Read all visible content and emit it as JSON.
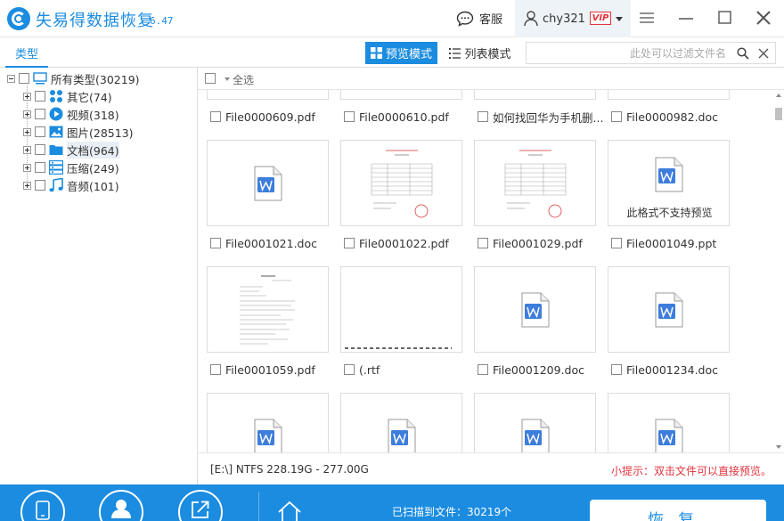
{
  "app": {
    "title": "失易得数据恢复",
    "version": "6.47",
    "service_label": "客服",
    "user_name": "chy321",
    "vip_label": "VIP"
  },
  "toolbar": {
    "tab_type": "类型",
    "preview_mode": "预览模式",
    "list_mode": "列表模式",
    "search_placeholder": "此处可以过滤文件名"
  },
  "tree": {
    "root": "所有类型(30219)",
    "items": [
      {
        "label": "其它(74)",
        "icon": "apps-icon"
      },
      {
        "label": "视频(318)",
        "icon": "video-icon"
      },
      {
        "label": "图片(28513)",
        "icon": "image-icon"
      },
      {
        "label": "文档(964)",
        "icon": "folder-icon"
      },
      {
        "label": "压缩(249)",
        "icon": "archive-icon"
      },
      {
        "label": "音频(101)",
        "icon": "music-icon"
      }
    ]
  },
  "content": {
    "select_all": "全选",
    "files": [
      {
        "name": "File0000609.pdf"
      },
      {
        "name": "File0000610.pdf"
      },
      {
        "name": "如何找回华为手机删..."
      },
      {
        "name": "File0000982.doc"
      },
      {
        "name": "File0001021.doc"
      },
      {
        "name": "File0001022.pdf"
      },
      {
        "name": "File0001029.pdf"
      },
      {
        "name": "File0001049.ppt",
        "note": "此格式不支持预览"
      },
      {
        "name": "File0001059.pdf"
      },
      {
        "name": "(.rtf"
      },
      {
        "name": "File0001209.doc"
      },
      {
        "name": "File0001234.doc"
      }
    ]
  },
  "status": {
    "drive_info": "[E:\\] NTFS 228.19G - 277.00G",
    "tip": "小提示：双击文件可以直接预览。"
  },
  "bottom": {
    "scan_status": "已扫描到文件：30219个",
    "recover_label": "恢复"
  },
  "colors": {
    "accent": "#1b8ce0",
    "warning": "#e3333c"
  }
}
